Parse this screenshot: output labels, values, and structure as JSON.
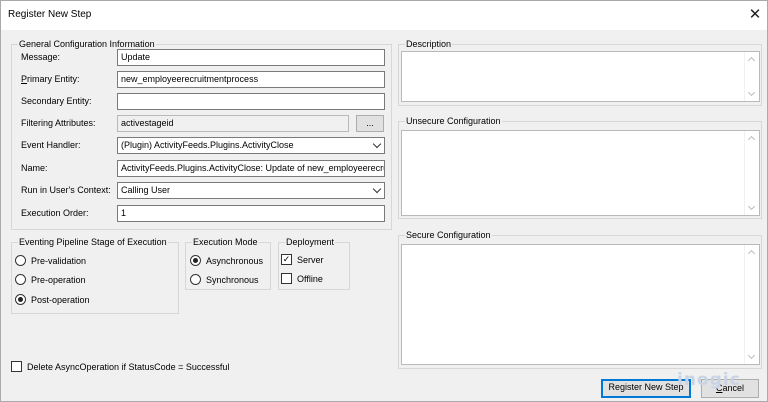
{
  "window": {
    "title": "Register New Step"
  },
  "general": {
    "legend": "General Configuration Information",
    "fields": [
      {
        "label": "Message:",
        "value": "Update"
      },
      {
        "label_first": "P",
        "label_rest": "rimary Entity:",
        "value": "new_employeerecruitmentprocess"
      },
      {
        "label": "Secondary Entity:",
        "value": ""
      },
      {
        "label": "Filtering Attributes:",
        "value": "activestageid",
        "browse": "..."
      },
      {
        "label": "Event Handler:",
        "value": "(Plugin) ActivityFeeds.Plugins.ActivityClose"
      },
      {
        "label": "Name:",
        "value": "ActivityFeeds.Plugins.ActivityClose: Update of new_employeerecruitmentprocess"
      },
      {
        "label": "Run in User's Context:",
        "value": "Calling User"
      },
      {
        "label": "Execution Order:",
        "value": "1"
      }
    ]
  },
  "stage": {
    "legend": "Eventing Pipeline Stage of Execution",
    "options": [
      {
        "label": "Pre-validation",
        "checked": false
      },
      {
        "label": "Pre-operation",
        "checked": false
      },
      {
        "label": "Post-operation",
        "checked": true
      }
    ]
  },
  "mode": {
    "legend": "Execution Mode",
    "options": [
      {
        "label": "Asynchronous",
        "checked": true
      },
      {
        "label": "Synchronous",
        "checked": false
      }
    ]
  },
  "deployment": {
    "legend": "Deployment",
    "options": [
      {
        "label": "Server",
        "checked": true
      },
      {
        "label": "Offline",
        "checked": false
      }
    ]
  },
  "delete_async": {
    "label": "Delete AsyncOperation if StatusCode = Successful",
    "checked": false
  },
  "description": {
    "legend": "Description",
    "value": ""
  },
  "unsecure": {
    "legend": "Unsecure Configuration",
    "value": ""
  },
  "secure": {
    "legend": "Secure Configuration",
    "value": ""
  },
  "buttons": {
    "register": "Register New Step",
    "cancel_first": "C",
    "cancel_rest": "ancel"
  },
  "watermark": "inogic"
}
